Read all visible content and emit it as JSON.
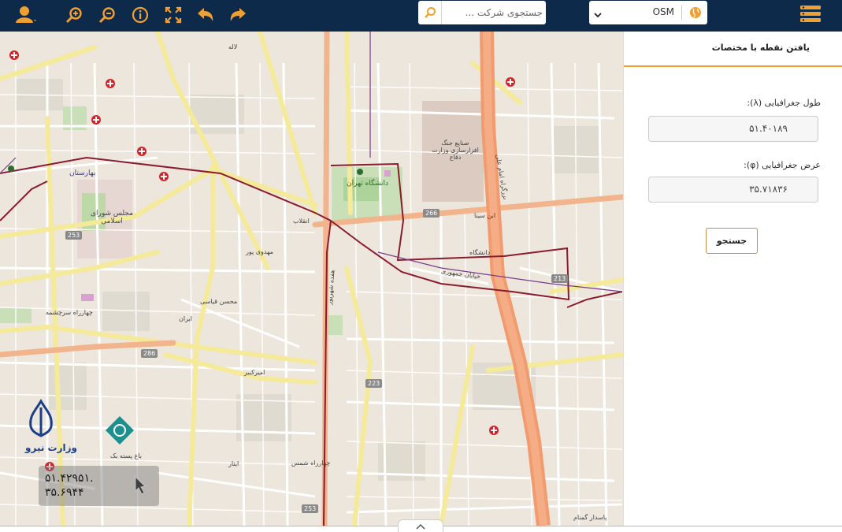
{
  "toolbar": {
    "search_placeholder": "جستجوی شرکت ...",
    "map_source": "OSM",
    "icons": [
      "user-icon",
      "zoom-in-icon",
      "zoom-out-icon",
      "info-icon",
      "fullscreen-icon",
      "undo-icon",
      "redo-icon",
      "search-icon",
      "globe-icon",
      "menu-icon"
    ]
  },
  "panel": {
    "title": "یافتن نقطه با مختصات",
    "longitude_label": "طول جغرافیایی (λ):",
    "longitude_value": "۵۱.۴۰۱۸۹",
    "latitude_label": "عرض جغرافیایی (φ):",
    "latitude_value": "۳۵.۷۱۸۳۶",
    "search_button": "جستجو"
  },
  "map": {
    "coord_lon": "۵۱.۴۲۹۵۱.",
    "coord_lat": "۳۵.۶۹۴۴",
    "logo_text": "وزارت نیرو",
    "labels": [
      {
        "text": "مجلس شورای اسلامی"
      },
      {
        "text": "بهارستان"
      },
      {
        "text": "دانشگاه تهران"
      },
      {
        "text": "صنایع جنگ افزارسازی وزارت دفاع"
      },
      {
        "text": "بزرگراه امام علی"
      },
      {
        "text": "انقلاب"
      },
      {
        "text": "خیابان جمهوری"
      },
      {
        "text": "امیرکبیر"
      },
      {
        "text": "هفده شهریور"
      },
      {
        "text": "ابن سینا"
      },
      {
        "text": "دانشگاه"
      },
      {
        "text": "چهارراه سرچشمه"
      },
      {
        "text": "چهارراه شمس"
      },
      {
        "text": "پاسدار گمنام"
      },
      {
        "text": "باغ پسته بک"
      },
      {
        "text": "ایثار"
      },
      {
        "text": "لاله"
      },
      {
        "text": "ایران"
      },
      {
        "text": "مهدوی پور"
      },
      {
        "text": "محسن قیاسی"
      }
    ],
    "road_numbers": [
      "253",
      "286",
      "266",
      "213",
      "223",
      "253"
    ]
  },
  "colors": {
    "topbar": "#0e2a4a",
    "accent": "#f0a030",
    "highway": "#f29b6f",
    "primary_road": "#f7f0a0",
    "route": "#8b1b2e"
  }
}
